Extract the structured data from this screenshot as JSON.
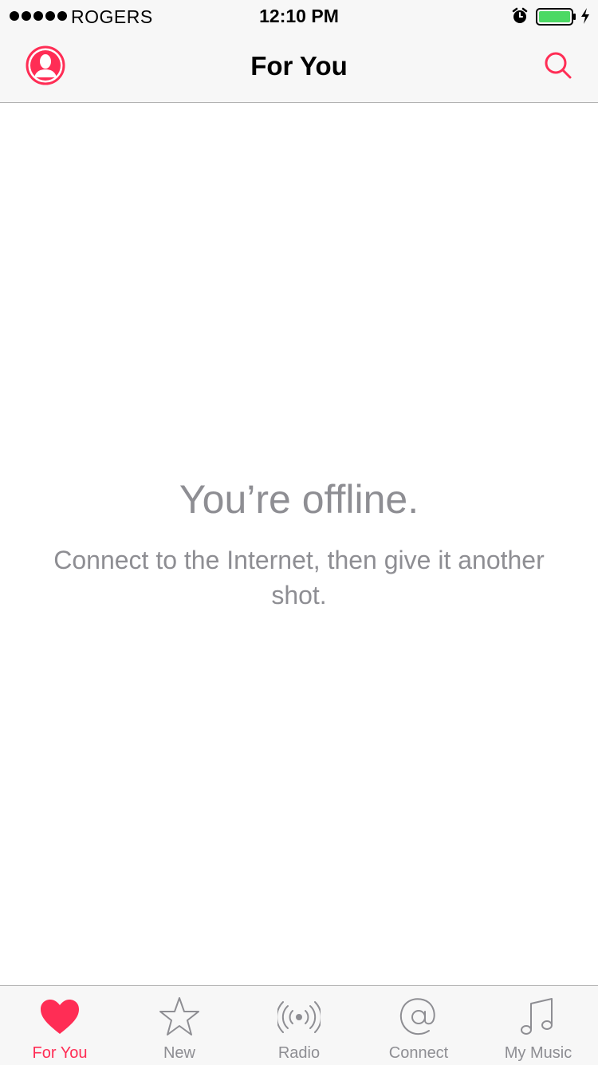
{
  "status_bar": {
    "carrier": "ROGERS",
    "time": "12:10 PM",
    "signal_bars": 5,
    "battery_level": 1.0,
    "battery_color": "#4cd964"
  },
  "nav": {
    "title": "For You",
    "profile_icon": "person-silhouette-icon",
    "search_icon": "search-icon"
  },
  "content": {
    "title": "You’re offline.",
    "message": "Connect to the Internet, then give it another shot."
  },
  "tabs": [
    {
      "label": "For You",
      "icon": "heart-icon",
      "active": true
    },
    {
      "label": "New",
      "icon": "star-icon",
      "active": false
    },
    {
      "label": "Radio",
      "icon": "radio-icon",
      "active": false
    },
    {
      "label": "Connect",
      "icon": "at-sign-icon",
      "active": false
    },
    {
      "label": "My Music",
      "icon": "music-note-icon",
      "active": false
    }
  ],
  "colors": {
    "accent": "#ff2d55",
    "inactive": "#8e8e93",
    "bar_background": "#f7f7f7"
  }
}
